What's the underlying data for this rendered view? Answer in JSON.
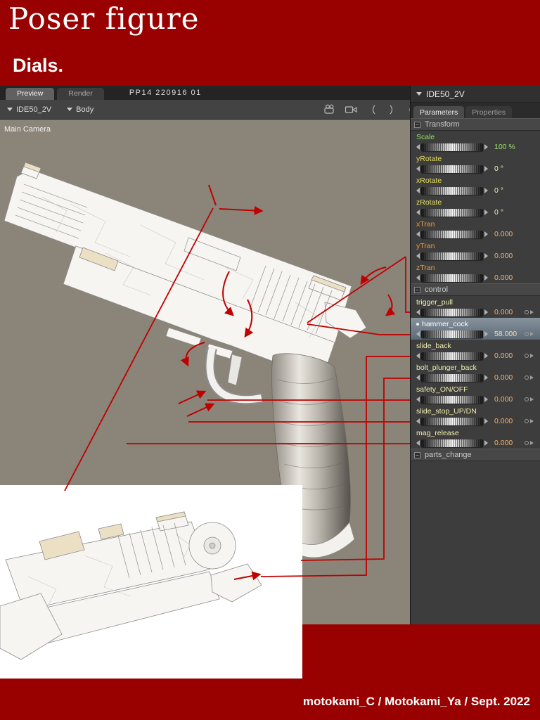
{
  "header": {
    "title": "Poser figure",
    "subtitle": "Dials."
  },
  "doc": {
    "tabs": [
      {
        "label": "Preview",
        "active": true
      },
      {
        "label": "Render",
        "active": false
      }
    ],
    "field": "PP14 220916 01",
    "dropdowns": [
      {
        "label": "IDE50_2V"
      },
      {
        "label": "Body"
      }
    ],
    "camera_label": "Main Camera",
    "toolbar_icons": [
      "film-camera-icon",
      "video-camera-icon",
      "orbit-left-icon",
      "orbit-right-icon",
      "trackball-icon",
      "move-cross-icon",
      "light-icon",
      "rotate-icon"
    ],
    "nav_icons": [
      "nav-left-icon",
      "nav-right-icon"
    ]
  },
  "panel": {
    "title": "IDE50_2V",
    "minus_glyph": "−",
    "tabs": [
      {
        "label": "Parameters",
        "active": true
      },
      {
        "label": "Properties",
        "active": false
      }
    ],
    "sections": [
      {
        "name": "Transform",
        "params": [
          {
            "label": "Scale",
            "value": "100 %",
            "label_color": "#8ee35e",
            "value_color": "#9be36a"
          },
          {
            "label": "yRotate",
            "value": "0 °",
            "label_color": "#e6de5c",
            "value_color": "#efefb9"
          },
          {
            "label": "xRotate",
            "value": "0 °",
            "label_color": "#e6de5c",
            "value_color": "#efefb9"
          },
          {
            "label": "zRotate",
            "value": "0 °",
            "label_color": "#e6de5c",
            "value_color": "#efefb9"
          },
          {
            "label": "xTran",
            "value": "0.000",
            "label_color": "#f09a3e",
            "value_color": "#f5b36b"
          },
          {
            "label": "yTran",
            "value": "0.000",
            "label_color": "#f09a3e",
            "value_color": "#f5b36b"
          },
          {
            "label": "zTran",
            "value": "0.000",
            "label_color": "#f09a3e",
            "value_color": "#f5b36b"
          }
        ]
      },
      {
        "name": "control",
        "params": [
          {
            "label": "trigger_pull",
            "value": "0.000",
            "label_color": "#efefad",
            "value_color": "#f5b36b"
          },
          {
            "label": "hammer_cock",
            "value": "58.000",
            "label_color": "#ffffff",
            "value_color": "#ffd9a0",
            "selected": true
          },
          {
            "label": "slide_back",
            "value": "0.000",
            "label_color": "#efefad",
            "value_color": "#f5b36b"
          },
          {
            "label": "bolt_plunger_back",
            "value": "0.000",
            "label_color": "#efefad",
            "value_color": "#f5b36b"
          },
          {
            "label": "safety_ON/OFF",
            "value": "0.000",
            "label_color": "#efefad",
            "value_color": "#f5b36b"
          },
          {
            "label": "slide_stop_UP/DN",
            "value": "0.000",
            "label_color": "#efefad",
            "value_color": "#f5b36b"
          },
          {
            "label": "mag_release",
            "value": "0.000",
            "label_color": "#efefad",
            "value_color": "#f5b36b"
          }
        ]
      },
      {
        "name": "parts_change",
        "params": []
      }
    ]
  },
  "footer": {
    "credit": "motokami_C / Motokami_Ya / Sept. 2022"
  },
  "colors": {
    "banner_red": "#990000",
    "annotation_red": "#c00000",
    "viewport_bg": "#8b8479"
  }
}
